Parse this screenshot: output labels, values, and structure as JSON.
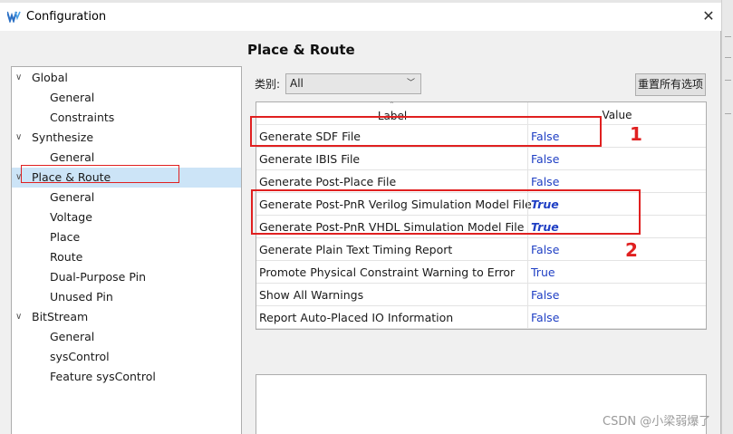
{
  "window": {
    "title": "Configuration",
    "close_glyph": "✕"
  },
  "tree": {
    "items": [
      {
        "label": "Global",
        "level": 0,
        "expanded": true
      },
      {
        "label": "General",
        "level": 1
      },
      {
        "label": "Constraints",
        "level": 1
      },
      {
        "label": "Synthesize",
        "level": 0,
        "expanded": true
      },
      {
        "label": "General",
        "level": 1
      },
      {
        "label": "Place & Route",
        "level": 0,
        "expanded": true,
        "selected": true
      },
      {
        "label": "General",
        "level": 1
      },
      {
        "label": "Voltage",
        "level": 1
      },
      {
        "label": "Place",
        "level": 1
      },
      {
        "label": "Route",
        "level": 1
      },
      {
        "label": "Dual-Purpose Pin",
        "level": 1
      },
      {
        "label": "Unused Pin",
        "level": 1
      },
      {
        "label": "BitStream",
        "level": 0,
        "expanded": true
      },
      {
        "label": "General",
        "level": 1
      },
      {
        "label": "sysControl",
        "level": 1
      },
      {
        "label": "Feature sysControl",
        "level": 1
      }
    ]
  },
  "main": {
    "title": "Place & Route",
    "category_label": "类别:",
    "category_value": "All",
    "reset_button": "重置所有选项",
    "table": {
      "headers": {
        "label": "Label",
        "value": "Value"
      },
      "rows": [
        {
          "label": "Generate SDF File",
          "value": "False",
          "emphasis": false
        },
        {
          "label": "Generate IBIS File",
          "value": "False",
          "emphasis": false
        },
        {
          "label": "Generate Post-Place File",
          "value": "False",
          "emphasis": false
        },
        {
          "label": "Generate Post-PnR Verilog Simulation Model File",
          "value": "True",
          "emphasis": true
        },
        {
          "label": "Generate Post-PnR VHDL Simulation Model File",
          "value": "True",
          "emphasis": true
        },
        {
          "label": "Generate Plain Text Timing Report",
          "value": "False",
          "emphasis": false
        },
        {
          "label": "Promote Physical Constraint Warning to Error",
          "value": "True",
          "emphasis": false
        },
        {
          "label": "Show All Warnings",
          "value": "False",
          "emphasis": false
        },
        {
          "label": "Report Auto-Placed IO Information",
          "value": "False",
          "emphasis": false
        }
      ]
    }
  },
  "annotations": {
    "marker_1": "1",
    "marker_2": "2"
  },
  "watermark": "CSDN @小梁弱爆了",
  "colors": {
    "value_blue": "#1f3fc4",
    "annotation_red": "#e02020",
    "selection": "#cce4f7"
  }
}
